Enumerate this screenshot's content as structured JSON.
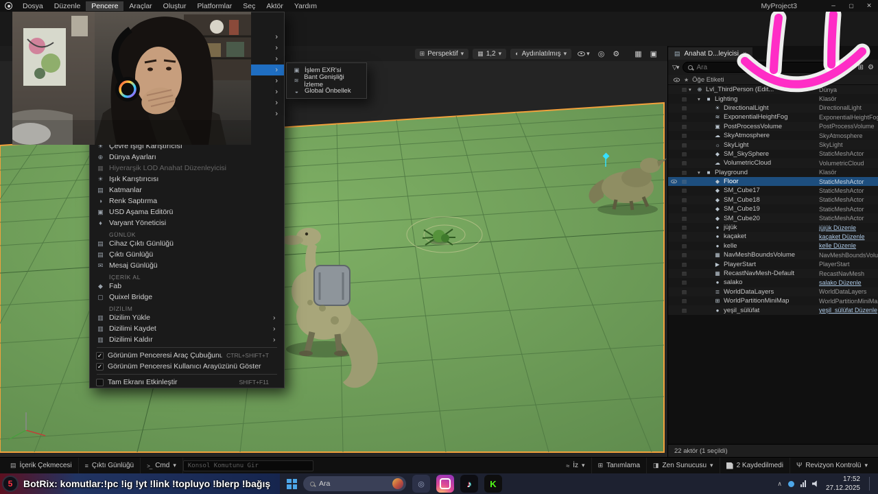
{
  "colors": {
    "accent": "#1f6ec2",
    "selection": "#1d4e7e",
    "outline_orange": "#f2a13c",
    "floor_green": "#75a55e",
    "grid_green": "#4e7842",
    "smiley_pink": "#ff2dc6",
    "kick_green": "#53fc18"
  },
  "menubar": {
    "project_title": "MyProject3",
    "items": [
      {
        "label": "Dosya"
      },
      {
        "label": "Düzenle"
      },
      {
        "label": "Pencere",
        "active": true
      },
      {
        "label": "Araçlar"
      },
      {
        "label": "Oluştur"
      },
      {
        "label": "Platformlar"
      },
      {
        "label": "Seç"
      },
      {
        "label": "Aktör"
      },
      {
        "label": "Yardım"
      }
    ]
  },
  "window_menu": {
    "covered_rows": [
      {
        "sub": true
      },
      {
        "sub": true
      },
      {
        "sub": true
      },
      {
        "sub": true,
        "hl": true
      },
      {
        "sub": true
      },
      {
        "sub": true
      },
      {
        "sub": true
      },
      {
        "sub": true
      }
    ],
    "items": [
      {
        "label": "Çevre Işığı Karıştırıcısı",
        "icon": "lightmix"
      },
      {
        "label": "Dünya Ayarları",
        "icon": "world"
      },
      {
        "label": "Hiyerarşik LOD Anahat Düzenleyicisi",
        "icon": "lod",
        "disabled": true
      },
      {
        "label": "Işık Karıştırıcısı",
        "icon": "lightmix"
      },
      {
        "label": "Katmanlar",
        "icon": "layers"
      },
      {
        "label": "Renk Saptırma",
        "icon": "color"
      },
      {
        "label": "USD Aşama Editörü",
        "icon": "usd"
      },
      {
        "label": "Varyant Yöneticisi",
        "icon": "variant"
      },
      {
        "label": "GÜNLÜK",
        "is_header": true
      },
      {
        "label": "Cihaz Çıktı Günlüğü",
        "icon": "log"
      },
      {
        "label": "Çıktı Günlüğü",
        "icon": "log"
      },
      {
        "label": "Mesaj Günlüğü",
        "icon": "message"
      },
      {
        "label": "İÇERİK AL",
        "is_header": true
      },
      {
        "label": "Fab",
        "icon": "fab"
      },
      {
        "label": "Quixel Bridge",
        "icon": "bridge"
      },
      {
        "label": "DİZİLİM",
        "is_header": true
      },
      {
        "label": "Dizilim Yükle",
        "icon": "layout",
        "submenu": true
      },
      {
        "label": "Dizilimi Kaydet",
        "icon": "layout",
        "submenu": true
      },
      {
        "label": "Dizilimi Kaldır",
        "icon": "layout",
        "submenu": true
      },
      {
        "is_divider": true
      },
      {
        "label": "Görünüm Penceresi Araç Çubuğunu Göster",
        "checkbox": true,
        "checked": true,
        "shortcut": "CTRL+SHIFT+T"
      },
      {
        "label": "Görünüm Penceresi Kullanıcı Arayüzünü Göster",
        "checkbox": true,
        "checked": true
      },
      {
        "is_divider": true
      },
      {
        "label": "Tam Ekranı Etkinleştir",
        "checkbox": true,
        "checked": false,
        "shortcut": "SHIFT+F11"
      }
    ],
    "submenu_items": [
      {
        "label": "İşlem EXR'si",
        "icon": "exr"
      },
      {
        "label": "Bant Genişliği İzleme",
        "icon": "bandwidth"
      },
      {
        "label": "Global Önbellek",
        "icon": "cache"
      }
    ]
  },
  "viewport": {
    "toolbar": {
      "perspective": "Perspektif",
      "snap": "1,2",
      "view_mode": "Aydınlatılmış"
    }
  },
  "outliner": {
    "tab_title": "Anahat D...leyicisi",
    "search_placeholder": "Ara",
    "header_label": "Öğe Etiketi",
    "footer": "22 aktör (1 seçildi)",
    "rows": [
      {
        "label": "Lvl_ThirdPerson (Edit...",
        "type": "Dünya",
        "icon": "level",
        "indent": 0,
        "expand": true
      },
      {
        "label": "Lighting",
        "type": "Klasör",
        "icon": "folder",
        "indent": 1,
        "expand": true
      },
      {
        "label": "DirectionalLight",
        "type": "DirectionalLight",
        "icon": "dirlight",
        "indent": 2
      },
      {
        "label": "ExponentialHeightFog",
        "type": "ExponentialHeightFog",
        "icon": "fog",
        "indent": 2
      },
      {
        "label": "PostProcessVolume",
        "type": "PostProcessVolume",
        "icon": "post",
        "indent": 2
      },
      {
        "label": "SkyAtmosphere",
        "type": "SkyAtmosphere",
        "icon": "atmo",
        "indent": 2
      },
      {
        "label": "SkyLight",
        "type": "SkyLight",
        "icon": "skylight",
        "indent": 2
      },
      {
        "label": "SM_SkySphere",
        "type": "StaticMeshActor",
        "icon": "mesh",
        "indent": 2
      },
      {
        "label": "VolumetricCloud",
        "type": "VolumetricCloud",
        "icon": "cloud",
        "indent": 2
      },
      {
        "label": "Playground",
        "type": "Klasör",
        "icon": "folder",
        "indent": 1,
        "expand": true
      },
      {
        "label": "Floor",
        "type": "StaticMeshActor",
        "icon": "mesh",
        "indent": 2,
        "selected": true,
        "eye": true
      },
      {
        "label": "SM_Cube17",
        "type": "StaticMeshActor",
        "icon": "mesh",
        "indent": 2
      },
      {
        "label": "SM_Cube18",
        "type": "StaticMeshActor",
        "icon": "mesh",
        "indent": 2
      },
      {
        "label": "SM_Cube19",
        "type": "StaticMeshActor",
        "icon": "mesh",
        "indent": 2
      },
      {
        "label": "SM_Cube20",
        "type": "StaticMeshActor",
        "icon": "mesh",
        "indent": 2
      },
      {
        "label": "jüjük",
        "type": "jüjük Düzenle",
        "icon": "pawn",
        "indent": 2,
        "link": true
      },
      {
        "label": "kaçaket",
        "type": "kaçaket Düzenle",
        "icon": "pawn",
        "indent": 2,
        "link": true
      },
      {
        "label": "kelle",
        "type": "kelle Düzenle",
        "icon": "pawn",
        "indent": 2,
        "link": true
      },
      {
        "label": "NavMeshBoundsVolume",
        "type": "NavMeshBoundsVolume",
        "icon": "nav",
        "indent": 2
      },
      {
        "label": "PlayerStart",
        "type": "PlayerStart",
        "icon": "player",
        "indent": 2
      },
      {
        "label": "RecastNavMesh-Default",
        "type": "RecastNavMesh",
        "icon": "recast",
        "indent": 2
      },
      {
        "label": "salako",
        "type": "salako Düzenle",
        "icon": "pawn",
        "indent": 2,
        "link": true
      },
      {
        "label": "WorldDataLayers",
        "type": "WorldDataLayers",
        "icon": "wdl",
        "indent": 2
      },
      {
        "label": "WorldPartitionMiniMap",
        "type": "WorldPartitionMiniMap",
        "icon": "minimap",
        "indent": 2
      },
      {
        "label": "yeşil_sülüfat",
        "type": "yeşil_sülüfat Düzenle",
        "icon": "pawn",
        "indent": 2,
        "link": true
      }
    ]
  },
  "statusbar": {
    "content_drawer": "İçerik Çekmecesi",
    "output_log": "Çıktı Günlüğü",
    "cmd": "Cmd",
    "console_placeholder": "Konsol Komutunu Gir",
    "trace": "İz",
    "diagnostics": "Tanımlama",
    "zen": "Zen Sunucusu",
    "unsaved": "2 Kaydedilmedi",
    "revision": "Revizyon Kontrolü"
  },
  "bottombar": {
    "badge": "5",
    "botrix_name": "BotRix",
    "botrix_message": ": komutlar:!pc !ig !yt !link !topluyo !blerp !bağış",
    "search_placeholder": "Ara",
    "tiktok_glyph": "♪",
    "kick_glyph": "K",
    "clock_time": "17:52",
    "clock_date": "27.12.2025"
  },
  "icon_glyphs": {
    "lightmix": "☀",
    "world": "⊕",
    "lod": "▦",
    "layers": "▤",
    "color": "◑",
    "usd": "▣",
    "variant": "♦",
    "log": "▤",
    "message": "✉",
    "fab": "◆",
    "bridge": "▢",
    "layout": "▥",
    "exr": "▣",
    "bandwidth": "≋",
    "cache": "◒",
    "level": "⊕",
    "folder": "■",
    "dirlight": "☀",
    "fog": "≋",
    "post": "▣",
    "atmo": "☁",
    "skylight": "☼",
    "mesh": "◆",
    "cloud": "☁",
    "pawn": "●",
    "nav": "▦",
    "player": "▶",
    "recast": "▦",
    "wdl": "≣",
    "minimap": "⊞"
  }
}
